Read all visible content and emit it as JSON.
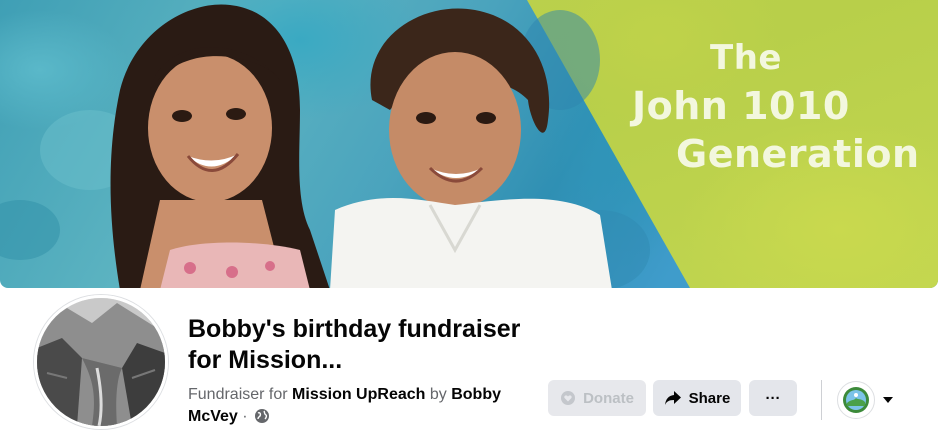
{
  "cover": {
    "title_line1": "The",
    "title_line2": "John 1010",
    "title_line3": "Generation"
  },
  "fundraiser": {
    "title": "Bobby's birthday fundraiser for Mission...",
    "prefix": "Fundraiser for",
    "organization": "Mission UpReach",
    "by_label": "by",
    "organizer": "Bobby McVey",
    "separator": "·",
    "privacy_icon": "globe-icon"
  },
  "actions": {
    "donate_label": "Donate",
    "share_label": "Share",
    "more_label": "···",
    "donate_icon": "heart-coin-icon",
    "share_icon": "share-arrow-icon",
    "dropdown_icon": "caret-down-icon"
  },
  "colors": {
    "cover_teal": "#3f9fb5",
    "cover_green": "#bdd24e",
    "button_bg": "#e4e6eb",
    "disabled_text": "#bcc0c4",
    "meta_text": "#65676b"
  }
}
